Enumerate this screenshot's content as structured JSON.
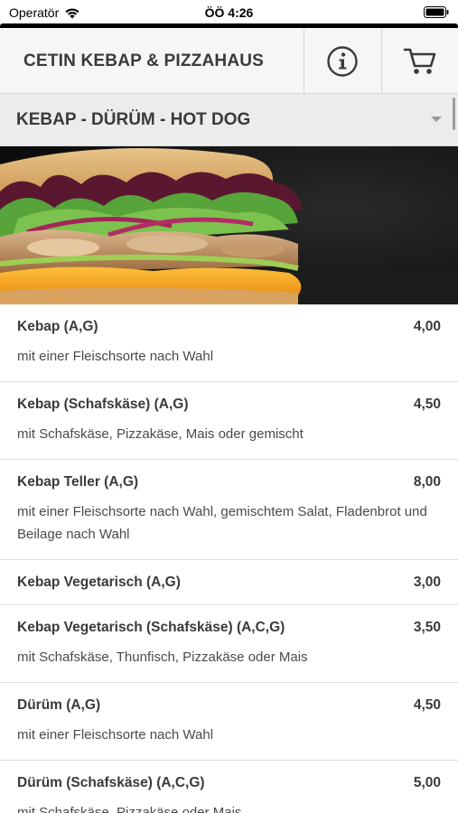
{
  "status_bar": {
    "carrier": "Operatör",
    "time": "ÖÖ 4:26"
  },
  "header": {
    "title": "CETIN KEBAP & PIZZAHAUS",
    "info_icon": "info-icon",
    "cart_icon": "cart-icon"
  },
  "category": {
    "label": "KEBAP - DÜRÜM - HOT DOG"
  },
  "menu": [
    {
      "name": "Kebap (A,G)",
      "price": "4,00",
      "desc": "mit einer Fleischsorte nach Wahl"
    },
    {
      "name": "Kebap (Schafskäse) (A,G)",
      "price": "4,50",
      "desc": "mit Schafskäse, Pizzakäse, Mais oder gemischt"
    },
    {
      "name": "Kebap Teller (A,G)",
      "price": "8,00",
      "desc": "mit einer Fleischsorte nach Wahl, gemischtem Salat, Fladenbrot und Beilage nach Wahl"
    },
    {
      "name": "Kebap Vegetarisch (A,G)",
      "price": "3,00",
      "desc": ""
    },
    {
      "name": "Kebap Vegetarisch (Schafskäse) (A,C,G)",
      "price": "3,50",
      "desc": "mit Schafskäse, Thunfisch, Pizzakäse oder Mais"
    },
    {
      "name": "Dürüm (A,G)",
      "price": "4,50",
      "desc": "mit einer Fleischsorte nach Wahl"
    },
    {
      "name": "Dürüm (Schafskäse) (A,C,G)",
      "price": "5,00",
      "desc": "mit Schafskäse, Pizzakäse oder Mais"
    }
  ],
  "colors": {
    "header_bg": "#f6f6f6",
    "category_bg": "#ececec",
    "text": "#3a3a3a"
  }
}
